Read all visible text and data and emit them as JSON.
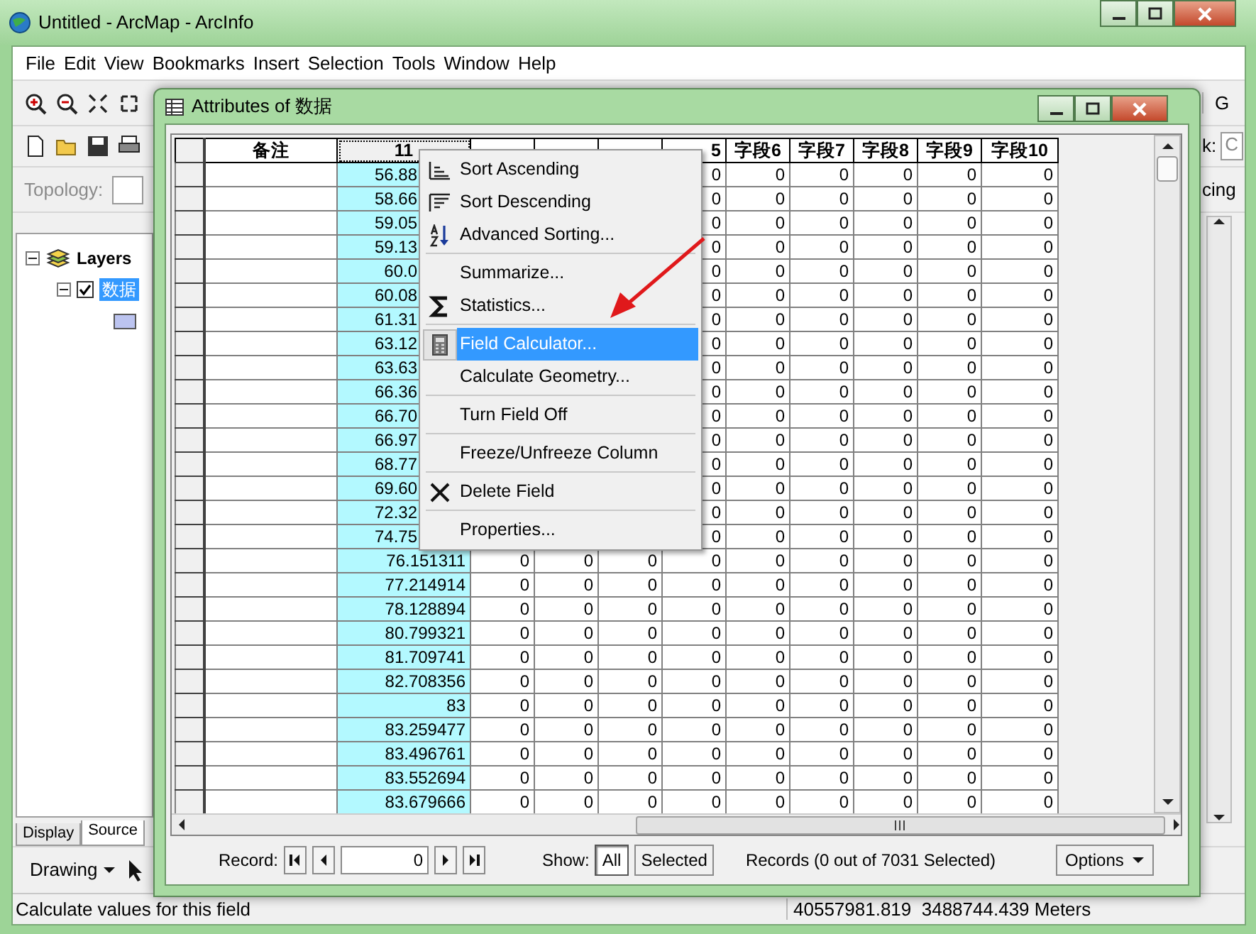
{
  "window": {
    "title": "Untitled - ArcMap - ArcInfo"
  },
  "menu_bar": [
    "File",
    "Edit",
    "View",
    "Bookmarks",
    "Insert",
    "Selection",
    "Tools",
    "Window",
    "Help"
  ],
  "toolbars": {
    "topology_label": "Topology:",
    "row1_fragment": "G",
    "row2_label": "k:",
    "row2_field": "C",
    "row3_fragment": "cing"
  },
  "toc": {
    "label": "Layers",
    "expanded": true,
    "children": [
      {
        "label": "数据",
        "expanded": true,
        "checked": true,
        "selected": true
      }
    ]
  },
  "toc_tabs": [
    {
      "label": "Display",
      "selected": false
    },
    {
      "label": "Source",
      "selected": true
    }
  ],
  "drawing_toolbar": {
    "label": "Drawing"
  },
  "status_bar": {
    "message": "Calculate values for this field",
    "coordinates": "40557981.819  3488744.439 Meters"
  },
  "attributes_window": {
    "title": "Attributes of 数据",
    "columns": [
      {
        "label": "备注",
        "selected": false
      },
      {
        "label": "11",
        "selected": true
      },
      {
        "selected": false
      },
      {
        "selected": false
      },
      {
        "selected": false
      },
      {
        "label": "5",
        "covered": true,
        "selected": false
      },
      {
        "label": "字段6",
        "selected": false
      },
      {
        "label": "字段7",
        "selected": false
      },
      {
        "label": "字段8",
        "selected": false
      },
      {
        "label": "字段9",
        "selected": false
      },
      {
        "label": "字段10",
        "selected": false
      }
    ],
    "rows": [
      {
        "covered": true,
        "cells": [
          null,
          "56.88",
          null,
          null,
          null,
          "0",
          "0",
          "0",
          "0",
          "0",
          "0"
        ]
      },
      {
        "covered": true,
        "cells": [
          null,
          "58.66",
          null,
          null,
          null,
          "0",
          "0",
          "0",
          "0",
          "0",
          "0"
        ]
      },
      {
        "covered": true,
        "cells": [
          null,
          "59.05",
          null,
          null,
          null,
          "0",
          "0",
          "0",
          "0",
          "0",
          "0"
        ]
      },
      {
        "covered": true,
        "cells": [
          null,
          "59.13",
          null,
          null,
          null,
          "0",
          "0",
          "0",
          "0",
          "0",
          "0"
        ]
      },
      {
        "covered": true,
        "cells": [
          null,
          "60.0",
          null,
          null,
          null,
          "0",
          "0",
          "0",
          "0",
          "0",
          "0"
        ]
      },
      {
        "covered": true,
        "cells": [
          null,
          "60.08",
          null,
          null,
          null,
          "0",
          "0",
          "0",
          "0",
          "0",
          "0"
        ]
      },
      {
        "covered": true,
        "cells": [
          null,
          "61.31",
          null,
          null,
          null,
          "0",
          "0",
          "0",
          "0",
          "0",
          "0"
        ]
      },
      {
        "covered": true,
        "cells": [
          null,
          "63.12",
          null,
          null,
          null,
          "0",
          "0",
          "0",
          "0",
          "0",
          "0"
        ]
      },
      {
        "covered": true,
        "cells": [
          null,
          "63.63",
          null,
          null,
          null,
          "0",
          "0",
          "0",
          "0",
          "0",
          "0"
        ]
      },
      {
        "covered": true,
        "cells": [
          null,
          "66.36",
          null,
          null,
          null,
          "0",
          "0",
          "0",
          "0",
          "0",
          "0"
        ]
      },
      {
        "covered": true,
        "cells": [
          null,
          "66.70",
          null,
          null,
          null,
          "0",
          "0",
          "0",
          "0",
          "0",
          "0"
        ]
      },
      {
        "covered": true,
        "cells": [
          null,
          "66.97",
          null,
          null,
          null,
          "0",
          "0",
          "0",
          "0",
          "0",
          "0"
        ]
      },
      {
        "covered": true,
        "cells": [
          null,
          "68.77",
          null,
          null,
          null,
          "0",
          "0",
          "0",
          "0",
          "0",
          "0"
        ]
      },
      {
        "covered": true,
        "cells": [
          null,
          "69.60",
          null,
          null,
          null,
          "0",
          "0",
          "0",
          "0",
          "0",
          "0"
        ]
      },
      {
        "covered": true,
        "cells": [
          null,
          "72.32",
          null,
          null,
          null,
          "0",
          "0",
          "0",
          "0",
          "0",
          "0"
        ]
      },
      {
        "covered": true,
        "cells": [
          null,
          "74.75",
          null,
          null,
          null,
          "0",
          "0",
          "0",
          "0",
          "0",
          "0"
        ]
      },
      {
        "covered": false,
        "cells": [
          null,
          "76.151311",
          "0",
          "0",
          "0",
          "0",
          "0",
          "0",
          "0",
          "0",
          "0"
        ]
      },
      {
        "covered": false,
        "cells": [
          null,
          "77.214914",
          "0",
          "0",
          "0",
          "0",
          "0",
          "0",
          "0",
          "0",
          "0"
        ]
      },
      {
        "covered": false,
        "cells": [
          null,
          "78.128894",
          "0",
          "0",
          "0",
          "0",
          "0",
          "0",
          "0",
          "0",
          "0"
        ]
      },
      {
        "covered": false,
        "cells": [
          null,
          "80.799321",
          "0",
          "0",
          "0",
          "0",
          "0",
          "0",
          "0",
          "0",
          "0"
        ]
      },
      {
        "covered": false,
        "cells": [
          null,
          "81.709741",
          "0",
          "0",
          "0",
          "0",
          "0",
          "0",
          "0",
          "0",
          "0"
        ]
      },
      {
        "covered": false,
        "cells": [
          null,
          "82.708356",
          "0",
          "0",
          "0",
          "0",
          "0",
          "0",
          "0",
          "0",
          "0"
        ]
      },
      {
        "covered": false,
        "cells": [
          null,
          "83",
          "0",
          "0",
          "0",
          "0",
          "0",
          "0",
          "0",
          "0",
          "0"
        ]
      },
      {
        "covered": false,
        "cells": [
          null,
          "83.259477",
          "0",
          "0",
          "0",
          "0",
          "0",
          "0",
          "0",
          "0",
          "0"
        ]
      },
      {
        "covered": false,
        "cells": [
          null,
          "83.496761",
          "0",
          "0",
          "0",
          "0",
          "0",
          "0",
          "0",
          "0",
          "0"
        ]
      },
      {
        "covered": false,
        "cells": [
          null,
          "83.552694",
          "0",
          "0",
          "0",
          "0",
          "0",
          "0",
          "0",
          "0",
          "0"
        ]
      },
      {
        "covered": false,
        "cells": [
          null,
          "83.679666",
          "0",
          "0",
          "0",
          "0",
          "0",
          "0",
          "0",
          "0",
          "0"
        ]
      }
    ],
    "record_label": "Record:",
    "record_value": "0",
    "show_label": "Show:",
    "show_options": [
      {
        "label": "All",
        "selected": true
      },
      {
        "label": "Selected",
        "selected": false
      }
    ],
    "records_summary": "Records (0 out of 7031 Selected)",
    "options_button": "Options"
  },
  "context_menu": {
    "groups": [
      [
        {
          "kind": "sort_ascending",
          "label": "Sort Ascending",
          "selected": false
        },
        {
          "kind": "sort_descending",
          "label": "Sort Descending",
          "selected": false
        },
        {
          "kind": "advanced_sort",
          "label": "Advanced Sorting...",
          "selected": false
        }
      ],
      [
        {
          "kind": "plain",
          "label": "Summarize...",
          "selected": false
        },
        {
          "kind": "statistics",
          "label": "Statistics...",
          "selected": false
        }
      ],
      [
        {
          "kind": "calculator",
          "label": "Field Calculator...",
          "selected": true
        },
        {
          "kind": "plain",
          "label": "Calculate Geometry...",
          "selected": false
        }
      ],
      [
        {
          "kind": "plain",
          "label": "Turn Field Off",
          "selected": false
        }
      ],
      [
        {
          "kind": "plain",
          "label": "Freeze/Unfreeze Column",
          "selected": false
        }
      ],
      [
        {
          "kind": "delete",
          "label": "Delete Field",
          "selected": false
        }
      ],
      [
        {
          "kind": "plain",
          "label": "Properties...",
          "selected": false
        }
      ]
    ]
  }
}
